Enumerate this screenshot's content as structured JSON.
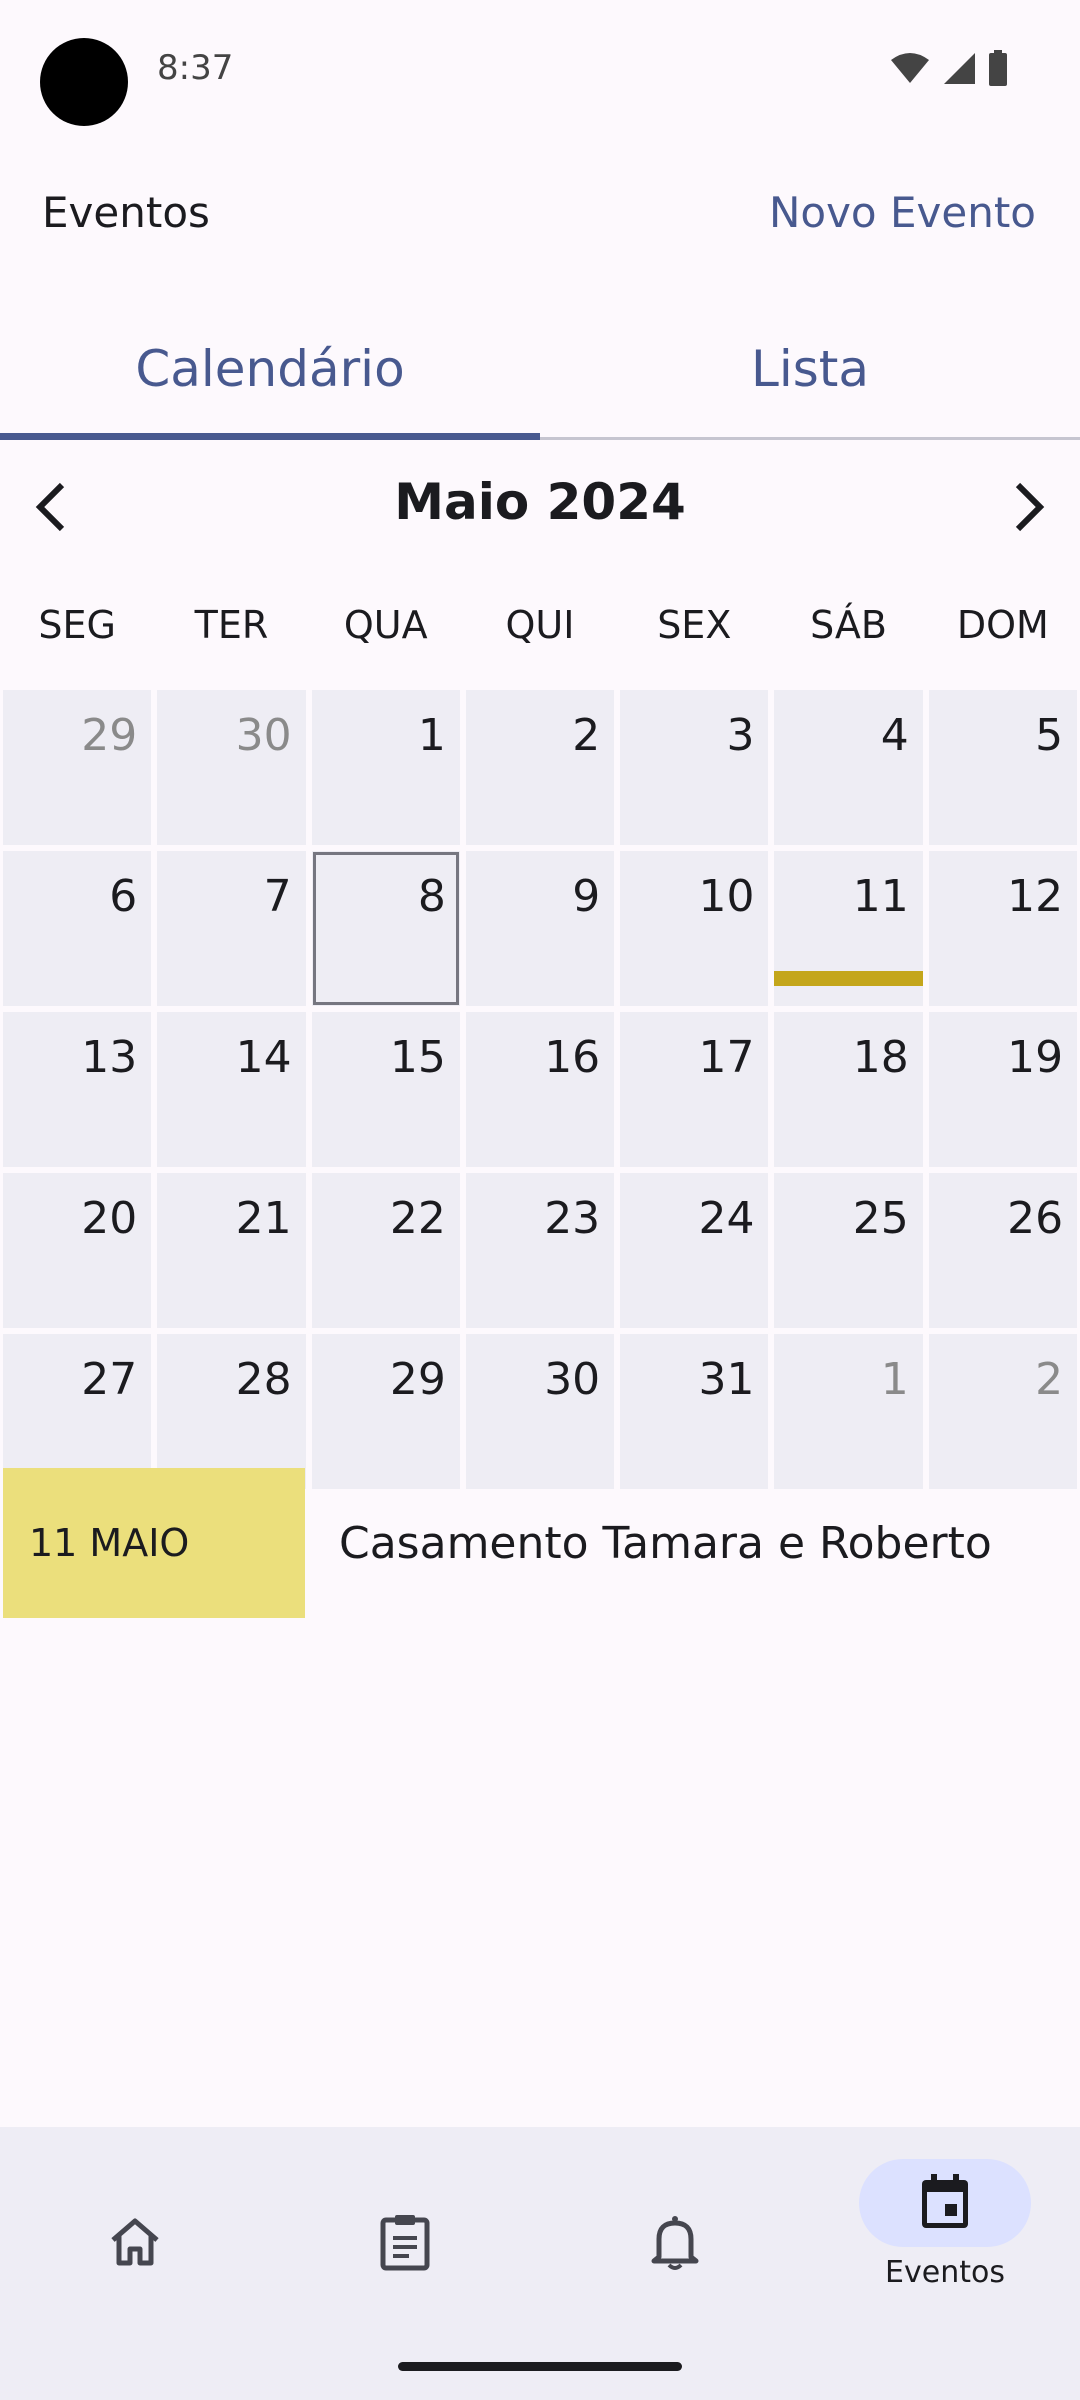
{
  "status_bar": {
    "time": "8:37"
  },
  "app_bar": {
    "title": "Eventos",
    "action": "Novo Evento"
  },
  "tabs": [
    {
      "label": "Calendário",
      "active": true
    },
    {
      "label": "Lista",
      "active": false
    }
  ],
  "calendar": {
    "month_title": "Maio 2024",
    "weekdays": [
      "SEG",
      "TER",
      "QUA",
      "QUI",
      "SEX",
      "SÁB",
      "DOM"
    ],
    "days": [
      {
        "n": "29",
        "muted": true
      },
      {
        "n": "30",
        "muted": true
      },
      {
        "n": "1"
      },
      {
        "n": "2"
      },
      {
        "n": "3"
      },
      {
        "n": "4"
      },
      {
        "n": "5"
      },
      {
        "n": "6"
      },
      {
        "n": "7"
      },
      {
        "n": "8",
        "today": true
      },
      {
        "n": "9"
      },
      {
        "n": "10"
      },
      {
        "n": "11",
        "event": true
      },
      {
        "n": "12"
      },
      {
        "n": "13"
      },
      {
        "n": "14"
      },
      {
        "n": "15"
      },
      {
        "n": "16"
      },
      {
        "n": "17"
      },
      {
        "n": "18"
      },
      {
        "n": "19"
      },
      {
        "n": "20"
      },
      {
        "n": "21"
      },
      {
        "n": "22"
      },
      {
        "n": "23"
      },
      {
        "n": "24"
      },
      {
        "n": "25"
      },
      {
        "n": "26"
      },
      {
        "n": "27"
      },
      {
        "n": "28"
      },
      {
        "n": "29"
      },
      {
        "n": "30"
      },
      {
        "n": "31"
      },
      {
        "n": "1",
        "muted": true
      },
      {
        "n": "2",
        "muted": true
      }
    ]
  },
  "events": [
    {
      "date": "11 MAIO",
      "title": "Casamento Tamara e Roberto"
    }
  ],
  "bottom_nav": {
    "items": [
      {
        "icon": "home-icon",
        "label": ""
      },
      {
        "icon": "clipboard-icon",
        "label": ""
      },
      {
        "icon": "bell-icon",
        "label": ""
      },
      {
        "icon": "calendar-icon",
        "label": "Eventos",
        "active": true
      }
    ]
  },
  "colors": {
    "accent": "#48598f",
    "event_bar": "#c4a61b",
    "event_date_bg": "#ebdf7c",
    "cell_bg": "#eeedf4",
    "active_pill": "#dce1ff"
  }
}
